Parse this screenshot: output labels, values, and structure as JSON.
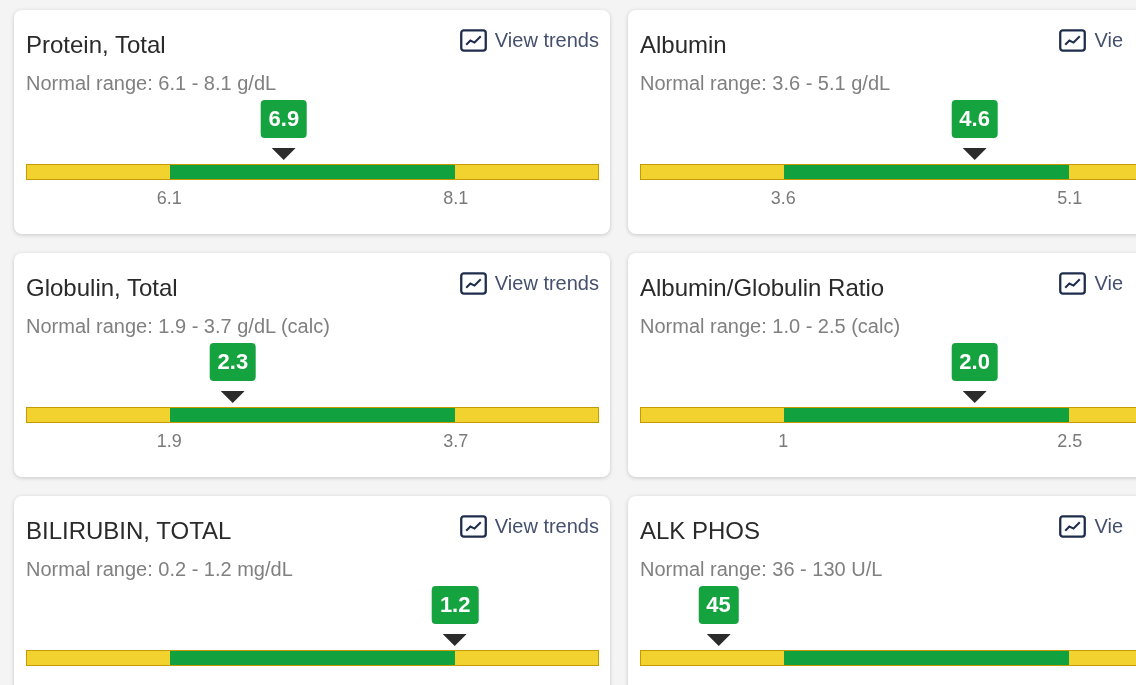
{
  "cards": [
    {
      "title": "Protein, Total",
      "link": "View trends",
      "range": "Normal range: 6.1 - 8.1 g/dL",
      "value": "6.9",
      "level": 0.45,
      "low_label": "6.1",
      "high_label": "8.1"
    },
    {
      "title": "Albumin",
      "link": "Vie",
      "range": "Normal range: 3.6 - 5.1 g/dL",
      "value": "4.6",
      "level": 0.584,
      "low_label": "3.6",
      "high_label": "5.1"
    },
    {
      "title": "Globulin, Total",
      "link": "View trends",
      "range": "Normal range: 1.9 - 3.7 g/dL (calc)",
      "value": "2.3",
      "level": 0.361,
      "low_label": "1.9",
      "high_label": "3.7"
    },
    {
      "title": "Albumin/Globulin Ratio",
      "link": "Vie",
      "range": "Normal range: 1.0 - 2.5 (calc)",
      "value": "2.0",
      "level": 0.584,
      "low_label": "1",
      "high_label": "2.5"
    },
    {
      "title": "BILIRUBIN, TOTAL",
      "link": "View trends",
      "range": "Normal range: 0.2 - 1.2 mg/dL",
      "value": "1.2",
      "level": 0.749
    },
    {
      "title": "ALK PHOS",
      "link": "Vie",
      "range": "Normal range: 36 - 130 U/L",
      "value": "45",
      "level": 0.137
    }
  ]
}
